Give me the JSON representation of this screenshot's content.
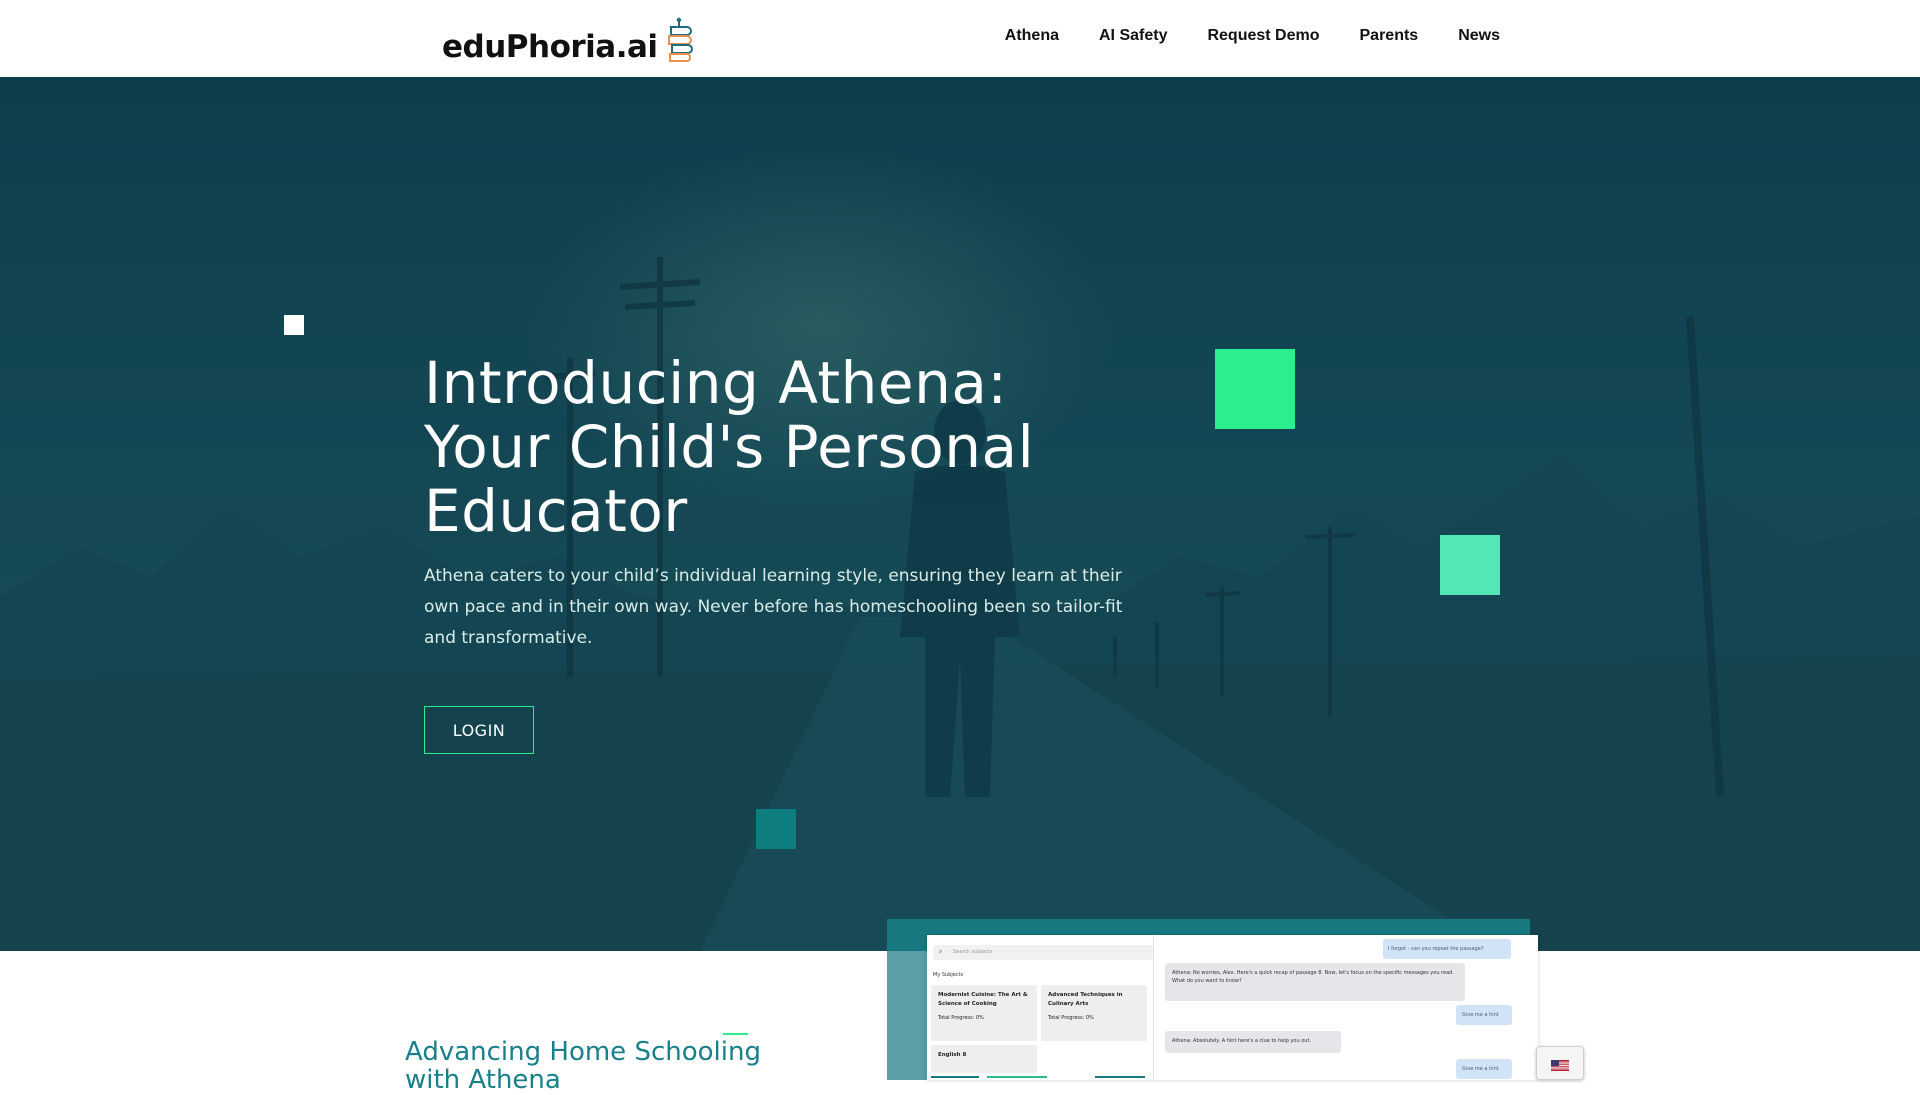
{
  "header": {
    "logo_text": "eduPhoria.ai",
    "nav": [
      "Athena",
      "AI Safety",
      "Request Demo",
      "Parents",
      "News"
    ]
  },
  "hero": {
    "title": "Introducing Athena: Your Child's Personal Educator",
    "subtitle": "Athena caters to your child’s individual learning style, ensuring they learn at their own pace and in their own way.  Never before has homeschooling been so tailor-fit and transformative.",
    "login_label": "LOGIN"
  },
  "section": {
    "title": "Advancing Home Schooling with Athena"
  },
  "preview": {
    "search_placeholder": "Search subjects",
    "my_subjects": "My Subjects",
    "cards": [
      {
        "title": "Modernist Cuisine: The Art & Science of Cooking",
        "progress": "Total Progress: 0%"
      },
      {
        "title": "Advanced Techniques in Culinary Arts",
        "progress": "Total Progress: 0%"
      },
      {
        "title": "English 8",
        "progress": ""
      }
    ],
    "chat": [
      {
        "role": "user",
        "text": "I forgot - can you repeat the passage?"
      },
      {
        "role": "bot",
        "text": "Athena: No worries, Alex. Here's a quick recap of passage 8. Now, let's focus on the specific messages you read. What do you want to know?"
      },
      {
        "role": "user",
        "text": "Give me a hint"
      },
      {
        "role": "bot",
        "text": "Athena: Absolutely. A hint here's a clue to help you out."
      },
      {
        "role": "user",
        "text": "Give me a hint"
      }
    ]
  },
  "colors": {
    "accent_green": "#2bef8f",
    "accent_mint": "#53e6b6",
    "accent_teal": "#0e7d80",
    "section_title": "#18808a"
  },
  "icons": [
    "flag-us-icon",
    "logo-books-icon",
    "search-icon"
  ]
}
